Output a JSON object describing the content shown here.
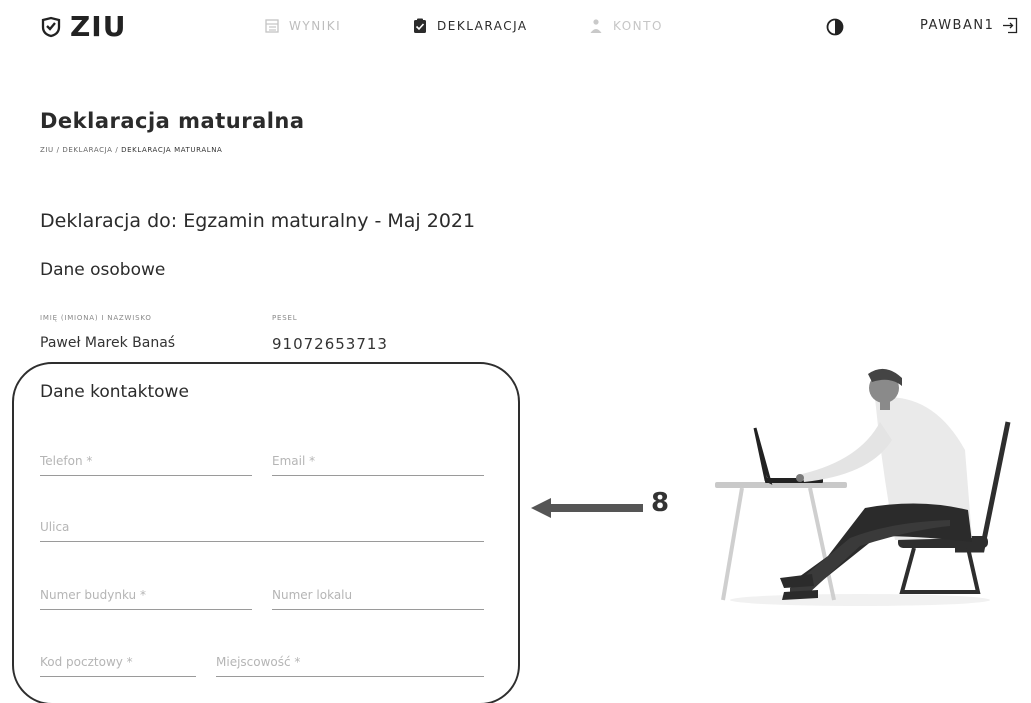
{
  "header": {
    "brand": "ZIU",
    "nav": [
      {
        "label": "WYNIKI",
        "icon": "results-icon"
      },
      {
        "label": "DEKLARACJA",
        "icon": "declaration-icon"
      },
      {
        "label": "KONTO",
        "icon": "account-icon"
      }
    ],
    "username": "PAWBAN1",
    "theme_icon": "contrast-icon",
    "logout_icon": "logout-icon"
  },
  "page": {
    "title": "Deklaracja maturalna",
    "breadcrumb": {
      "part1": "ZIU / DEKLARACJA / ",
      "current": "DEKLARACJA MATURALNA"
    },
    "declaration_for": "Deklaracja do: Egzamin maturalny - Maj 2021"
  },
  "personal": {
    "heading": "Dane osobowe",
    "name_label": "IMIĘ (IMIONA) I NAZWISKO",
    "name_value": "Paweł Marek Banaś",
    "pesel_label": "PESEL",
    "pesel_value": "91072653713"
  },
  "contact": {
    "heading": "Dane kontaktowe",
    "phone_placeholder": "Telefon *",
    "email_placeholder": "Email *",
    "street_placeholder": "Ulica",
    "building_placeholder": "Numer budynku *",
    "apartment_placeholder": "Numer lokalu",
    "postal_placeholder": "Kod pocztowy *",
    "city_placeholder": "Miejscowość *"
  },
  "annotation": {
    "number": "8"
  },
  "colors": {
    "text": "#2b2b2b",
    "muted": "#bdbdbd",
    "underline": "#9a9a9a"
  }
}
